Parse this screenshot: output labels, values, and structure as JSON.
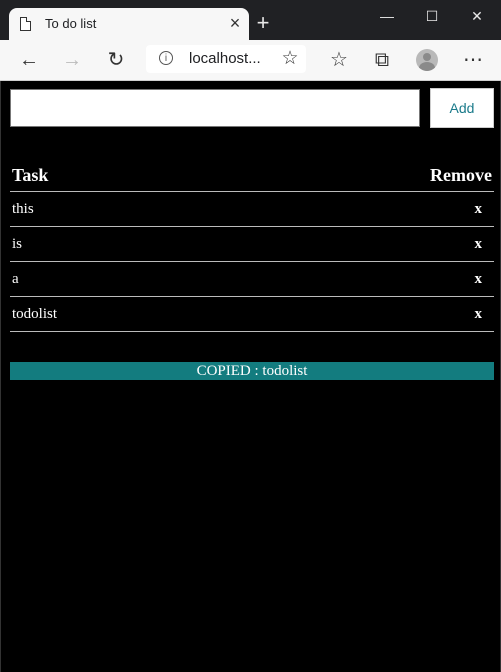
{
  "browser": {
    "tab_title": "To do list",
    "url": "localhost..."
  },
  "form": {
    "input_value": "",
    "add_label": "Add"
  },
  "table": {
    "headers": {
      "task": "Task",
      "remove": "Remove"
    },
    "rows": [
      {
        "task": "this",
        "remove": "x"
      },
      {
        "task": "is",
        "remove": "x"
      },
      {
        "task": "a",
        "remove": "x"
      },
      {
        "task": "todolist",
        "remove": "x"
      }
    ]
  },
  "status": {
    "text": "COPIED : todolist",
    "color": "#137c7f"
  },
  "icons": [
    "document-icon",
    "close-icon",
    "plus-icon",
    "minimize-icon",
    "maximize-icon",
    "window-close-icon",
    "back-arrow-icon",
    "forward-arrow-icon",
    "refresh-icon",
    "info-icon",
    "star-icon",
    "favorites-icon",
    "collections-icon",
    "avatar",
    "more-icon"
  ]
}
